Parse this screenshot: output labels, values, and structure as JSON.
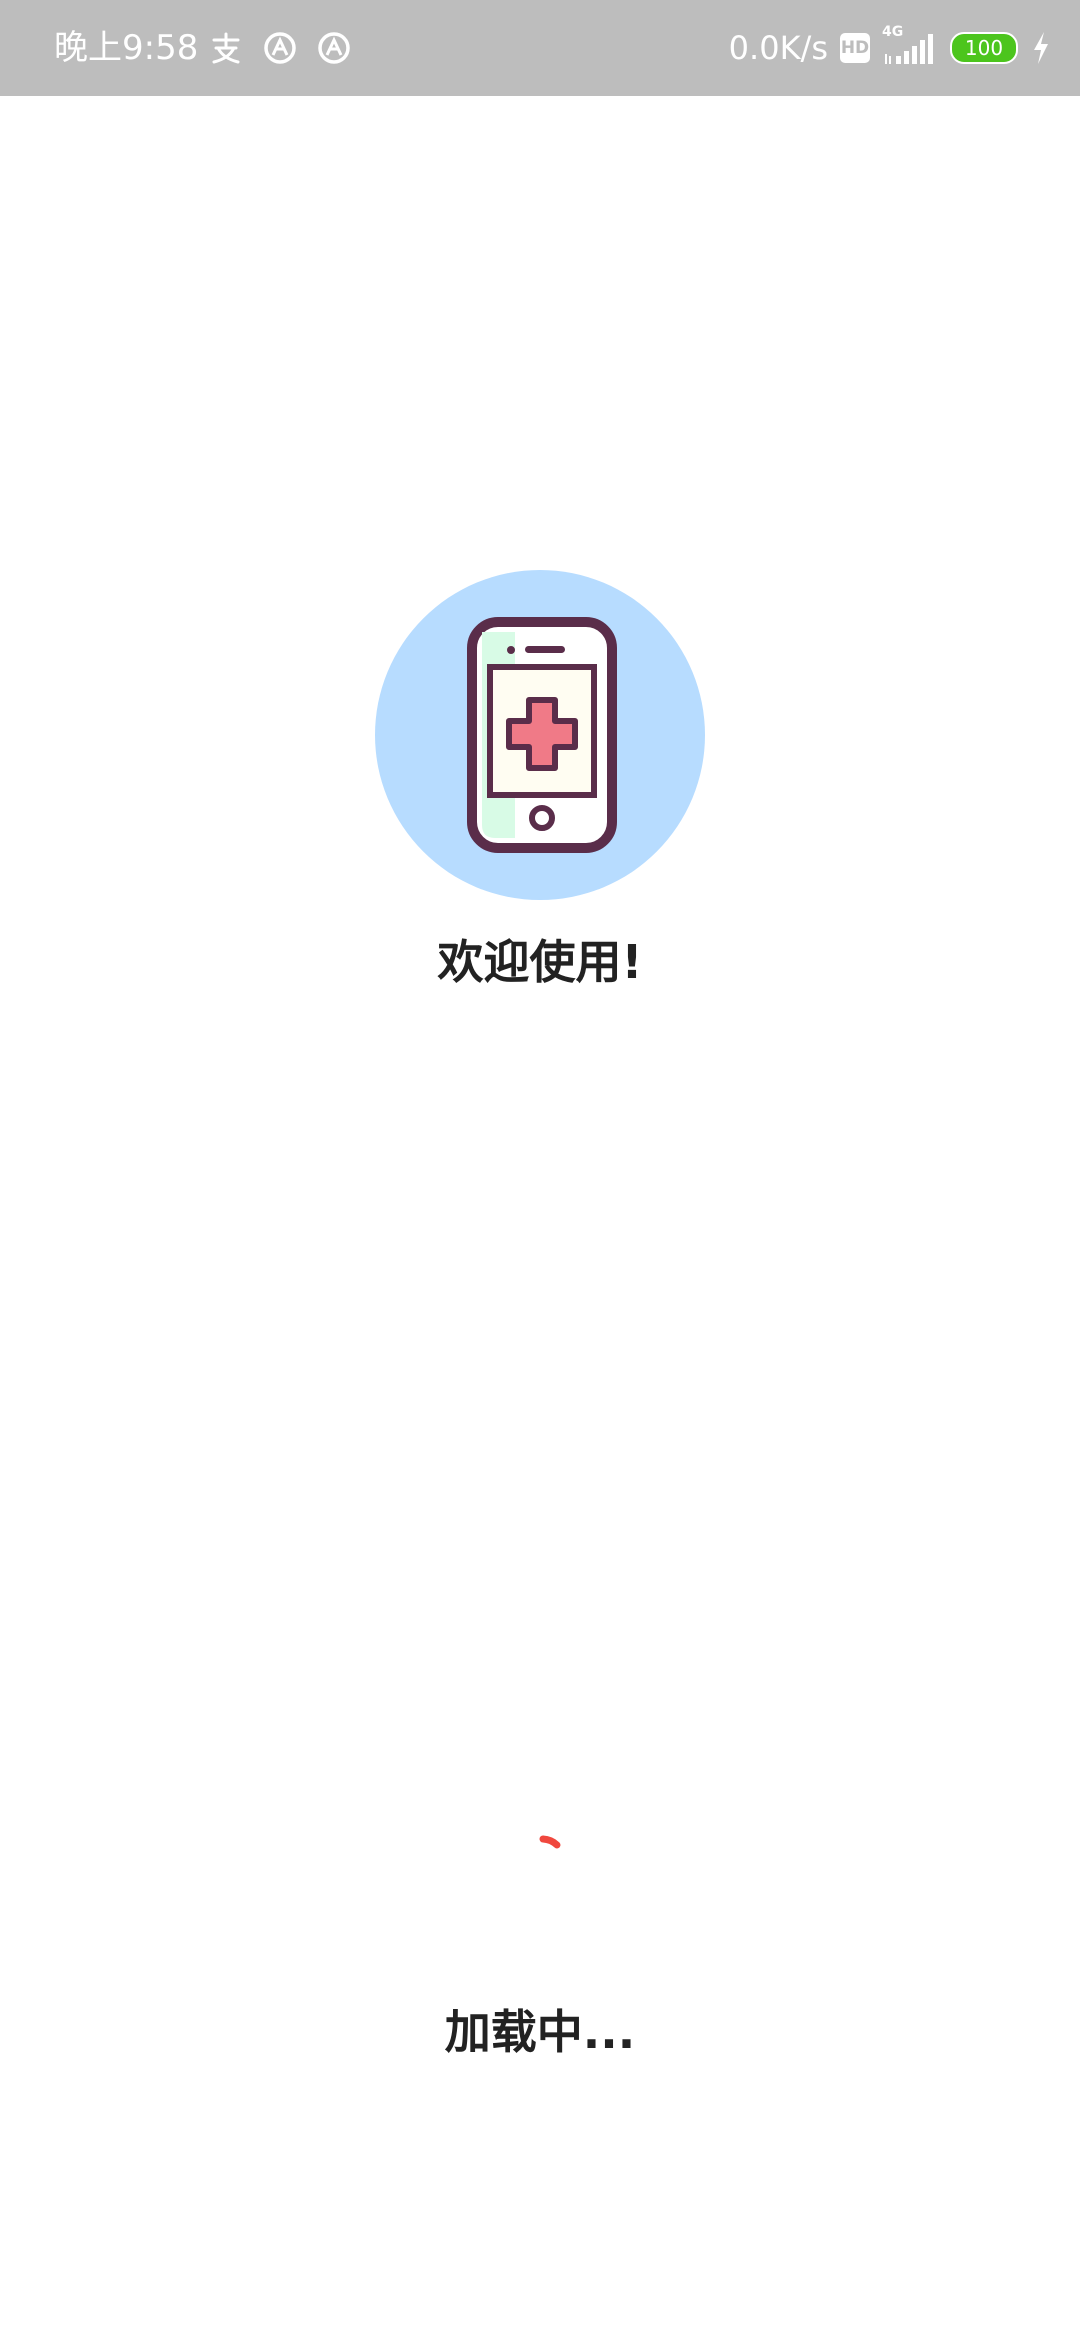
{
  "status_bar": {
    "time": "晚上9:58",
    "net_speed": "0.0K/s",
    "hd_label": "HD",
    "network_type": "4G",
    "battery_level": "100",
    "icons": [
      "alipay-icon",
      "at-icon",
      "at-icon",
      "hd-icon",
      "signal-icon",
      "battery-icon",
      "charging-icon"
    ]
  },
  "splash": {
    "logo_icon": "medical-phone-icon",
    "welcome_text": "欢迎使用!",
    "loading_text": "加载中..."
  },
  "colors": {
    "status_bar_bg": "#bdbdbd",
    "logo_circle": "#b7dcff",
    "phone_outline": "#5a2d4a",
    "cross_fill": "#f07a87",
    "spinner": "#f0483e",
    "battery_fill": "#4cc51d"
  }
}
